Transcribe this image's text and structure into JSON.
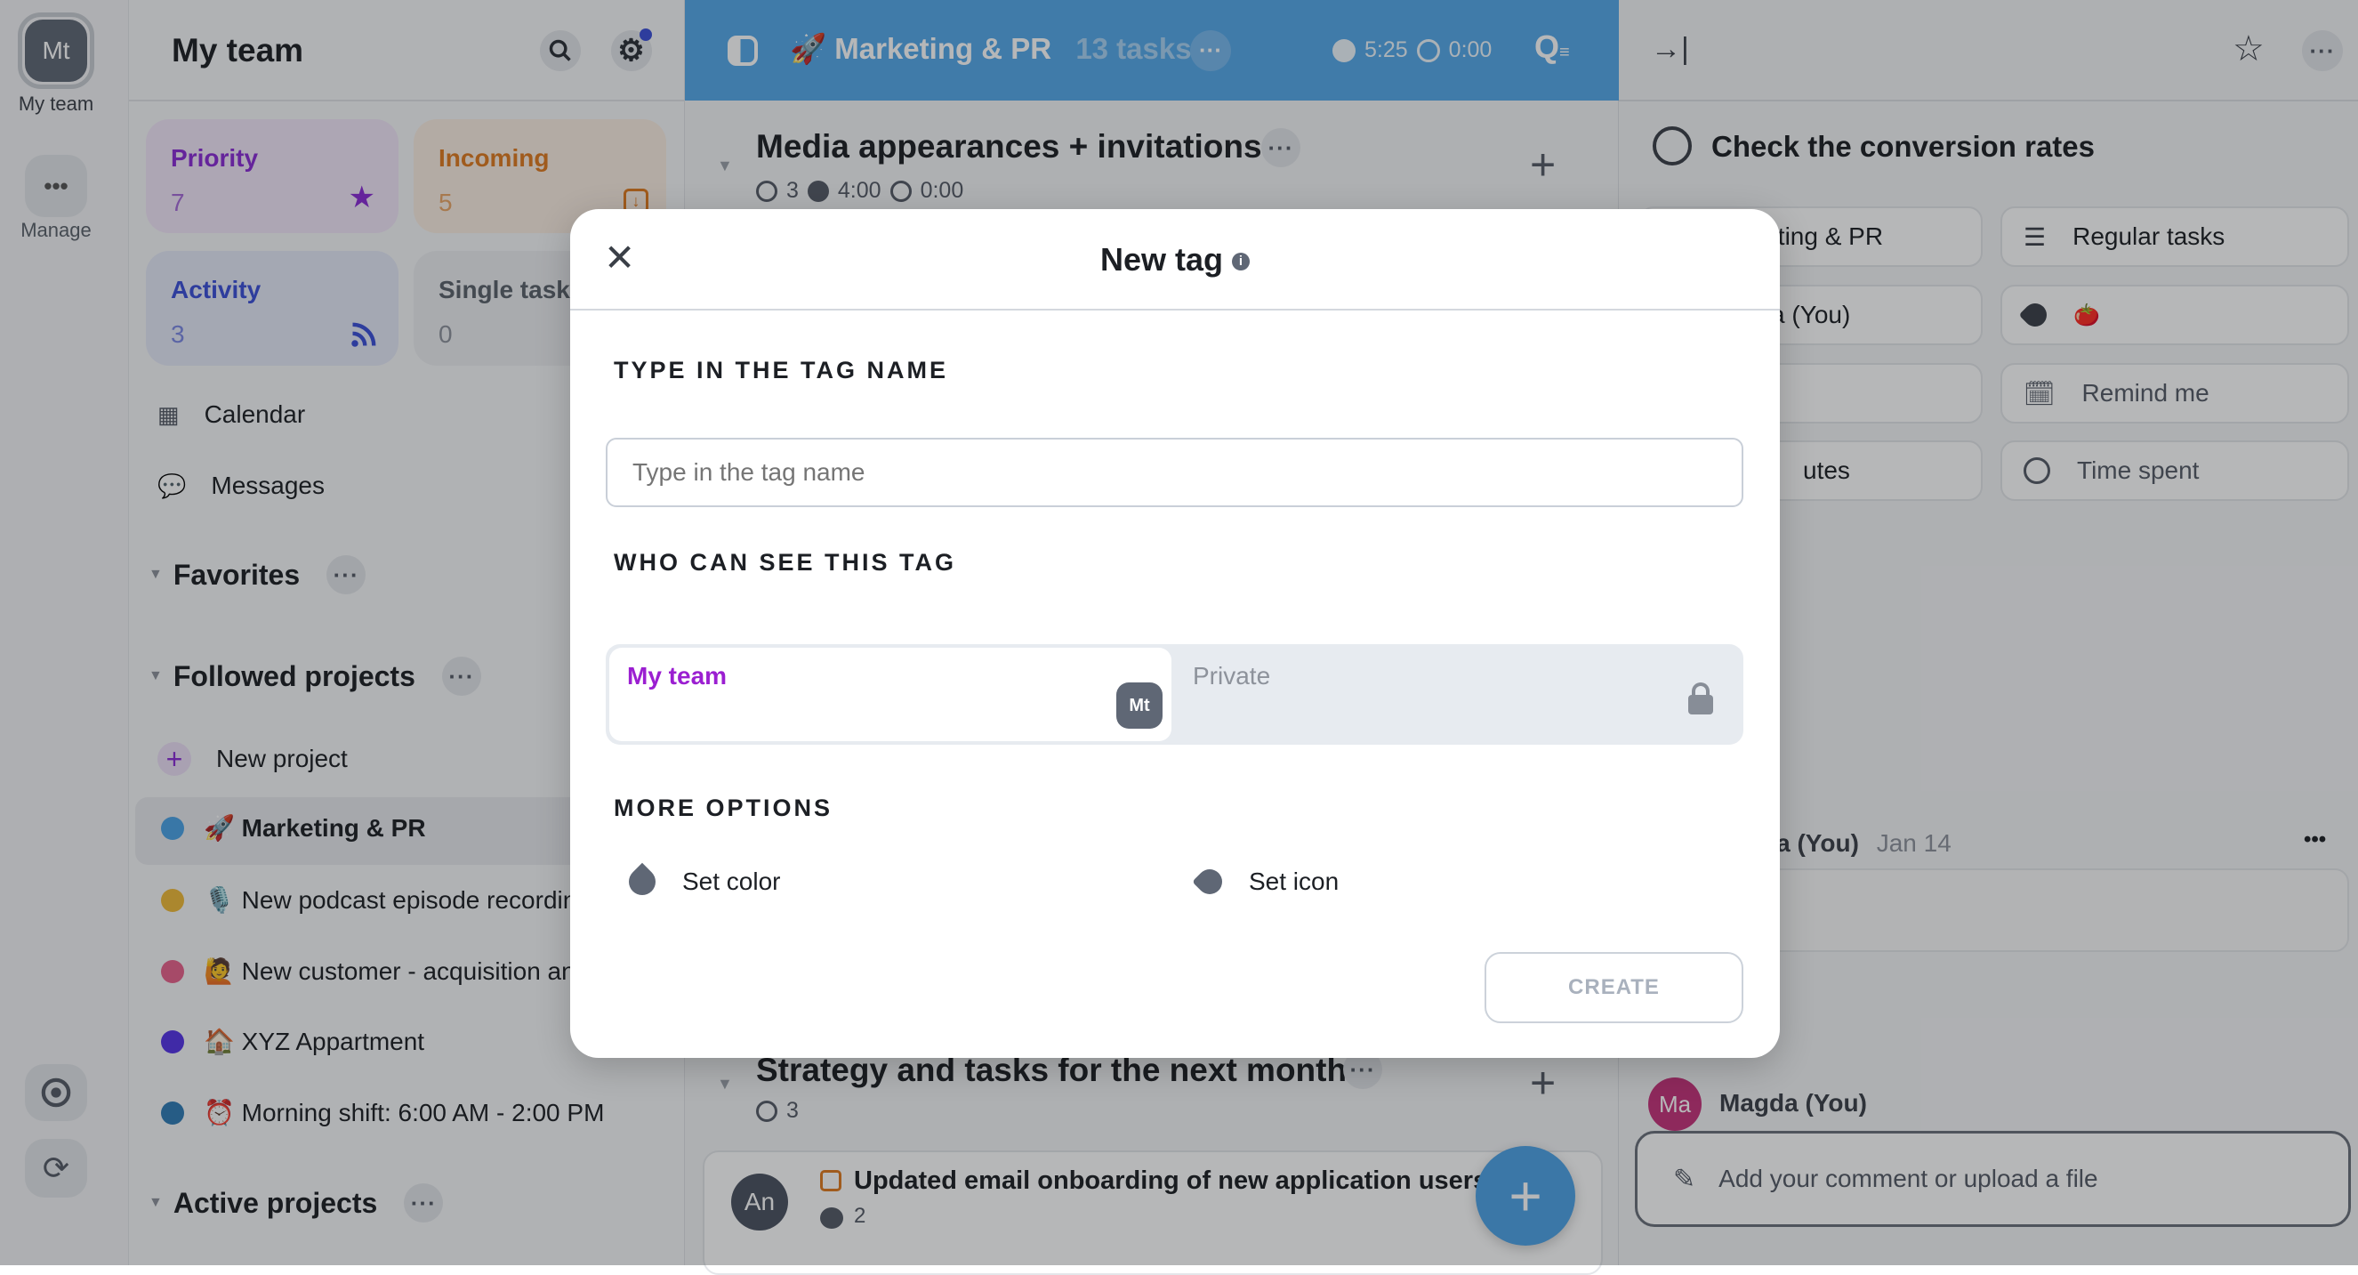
{
  "rail": {
    "avatar_initials": "Mt",
    "team_label": "My team",
    "manage_label": "Manage"
  },
  "sidebar": {
    "title": "My team",
    "cards": [
      {
        "label": "Priority",
        "count": "7",
        "color": "#8a2bd6",
        "icon": "star-icon"
      },
      {
        "label": "Incoming",
        "count": "5",
        "color": "#e07a1f",
        "icon": "inbox-download-icon"
      },
      {
        "label": "Activity",
        "count": "3",
        "color": "#3b4fd8",
        "icon": "rss-icon"
      },
      {
        "label": "Single tasks",
        "count": "0",
        "color": "#5b616b",
        "icon": ""
      }
    ],
    "nav": [
      {
        "label": "Calendar"
      },
      {
        "label": "Messages"
      }
    ],
    "favorites": "Favorites",
    "followed": "Followed projects",
    "new_project": "New project",
    "projects": [
      {
        "emoji": "🚀",
        "label": "Marketing & PR",
        "color": "#4aa3e6"
      },
      {
        "emoji": "🎙️",
        "label": "New podcast episode recording",
        "color": "#f0ba38"
      },
      {
        "emoji": "🙋",
        "label": "New customer - acquisition and onboarding",
        "color": "#e8628c"
      },
      {
        "emoji": "🏠",
        "label": "XYZ Appartment",
        "color": "#5433e6"
      },
      {
        "emoji": "⏰",
        "label": "Morning shift: 6:00 AM - 2:00 PM",
        "color": "#2f7bb5"
      }
    ],
    "active": "Active projects"
  },
  "center": {
    "header": {
      "emoji": "🚀",
      "project": "Marketing & PR",
      "tasks": "13 tasks",
      "estimate": "5:25",
      "spent": "0:00",
      "color": "#55a8ea"
    },
    "sections": [
      {
        "title": "Media appearances + invitations",
        "count": "3",
        "estimate": "4:00",
        "spent": "0:00"
      },
      {
        "title": "Strategy and tasks for the next month",
        "count": "3"
      }
    ],
    "task": {
      "avatar": "An",
      "title": "Updated email onboarding of new application users",
      "comments": "2"
    }
  },
  "right": {
    "task_title": "Check the conversion rates",
    "props_left": [
      "Marketing & PR",
      "Magda (You)",
      "",
      "utes"
    ],
    "props_right": [
      {
        "label": "Regular tasks",
        "icon": "list-icon"
      },
      {
        "label": "🍅",
        "icon": "tag-icon"
      },
      {
        "label": "Remind me",
        "icon": "calendar-bell-icon"
      },
      {
        "label": "Time spent",
        "icon": "pie-icon"
      }
    ],
    "comment": {
      "author": "Magda (You)",
      "date": "Jan 14"
    },
    "composer": {
      "avatar": "Ma",
      "author": "Magda (You)",
      "placeholder": "Add your comment or upload a file",
      "avatar_color": "#c6327a"
    }
  },
  "modal": {
    "title": "New tag",
    "name_heading": "TYPE IN THE TAG NAME",
    "name_placeholder": "Type in the tag name",
    "name_value": "",
    "visibility_heading": "WHO CAN SEE THIS TAG",
    "visibility_options": [
      {
        "label": "My team",
        "badge": "Mt",
        "selected": true
      },
      {
        "label": "Private",
        "selected": false
      }
    ],
    "more_heading": "MORE OPTIONS",
    "set_color": "Set color",
    "set_icon": "Set icon",
    "create": "CREATE",
    "accent": "#9b1fd1"
  }
}
